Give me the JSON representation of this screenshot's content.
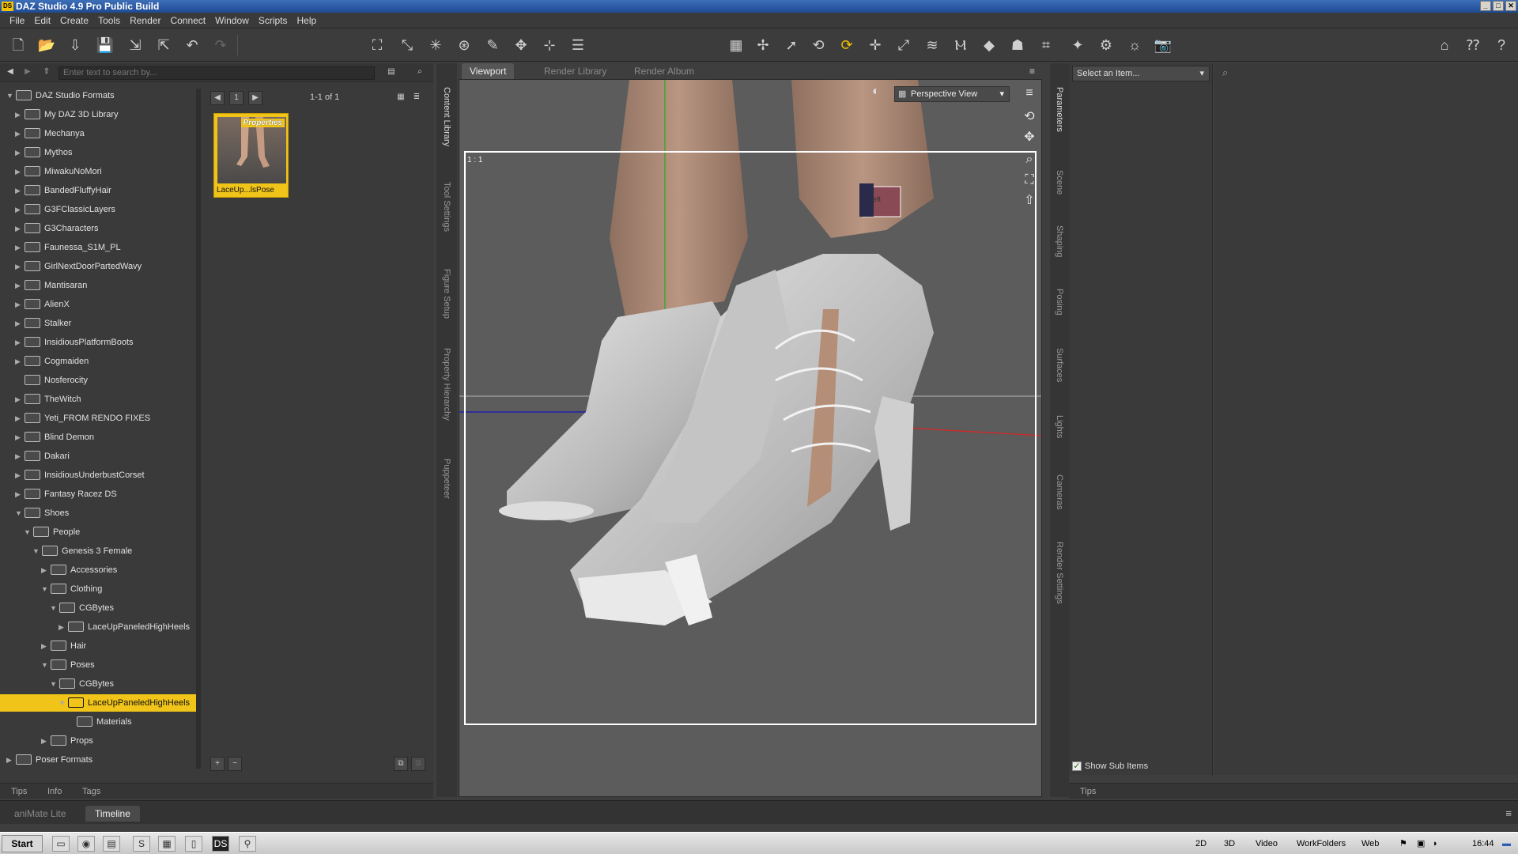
{
  "window": {
    "title": "DAZ Studio 4.9 Pro Public Build",
    "logo": "DS"
  },
  "menu": [
    "File",
    "Edit",
    "Create",
    "Tools",
    "Render",
    "Connect",
    "Window",
    "Scripts",
    "Help"
  ],
  "content_library": {
    "search_placeholder": "Enter text to search by...",
    "tree": [
      {
        "label": "DAZ Studio Formats",
        "depth": 0,
        "arrow": "down"
      },
      {
        "label": "My DAZ 3D Library",
        "depth": 1,
        "arrow": "right"
      },
      {
        "label": "Mechanya",
        "depth": 1,
        "arrow": "right"
      },
      {
        "label": "Mythos",
        "depth": 1,
        "arrow": "right"
      },
      {
        "label": "MiwakuNoMori",
        "depth": 1,
        "arrow": "right"
      },
      {
        "label": "BandedFluffyHair",
        "depth": 1,
        "arrow": "right"
      },
      {
        "label": "G3FClassicLayers",
        "depth": 1,
        "arrow": "right"
      },
      {
        "label": "G3Characters",
        "depth": 1,
        "arrow": "right"
      },
      {
        "label": "Faunessa_S1M_PL",
        "depth": 1,
        "arrow": "right"
      },
      {
        "label": "GirlNextDoorPartedWavy",
        "depth": 1,
        "arrow": "right"
      },
      {
        "label": "Mantisaran",
        "depth": 1,
        "arrow": "right"
      },
      {
        "label": "AlienX",
        "depth": 1,
        "arrow": "right"
      },
      {
        "label": "Stalker",
        "depth": 1,
        "arrow": "right"
      },
      {
        "label": "InsidiousPlatformBoots",
        "depth": 1,
        "arrow": "right"
      },
      {
        "label": "Cogmaiden",
        "depth": 1,
        "arrow": "right"
      },
      {
        "label": "Nosferocity",
        "depth": 1,
        "arrow": ""
      },
      {
        "label": "TheWitch",
        "depth": 1,
        "arrow": "right"
      },
      {
        "label": "Yeti_FROM RENDO FIXES",
        "depth": 1,
        "arrow": "right"
      },
      {
        "label": "Blind Demon",
        "depth": 1,
        "arrow": "right"
      },
      {
        "label": "Dakari",
        "depth": 1,
        "arrow": "right"
      },
      {
        "label": "InsidiousUnderbustCorset",
        "depth": 1,
        "arrow": "right"
      },
      {
        "label": "Fantasy Racez DS",
        "depth": 1,
        "arrow": "right"
      },
      {
        "label": "Shoes",
        "depth": 1,
        "arrow": "down"
      },
      {
        "label": "People",
        "depth": 2,
        "arrow": "down"
      },
      {
        "label": "Genesis 3 Female",
        "depth": 3,
        "arrow": "down"
      },
      {
        "label": "Accessories",
        "depth": 4,
        "arrow": "right"
      },
      {
        "label": "Clothing",
        "depth": 4,
        "arrow": "down"
      },
      {
        "label": "CGBytes",
        "depth": 5,
        "arrow": "down"
      },
      {
        "label": "LaceUpPaneledHighHeels",
        "depth": 6,
        "arrow": "right"
      },
      {
        "label": "Hair",
        "depth": 4,
        "arrow": "right"
      },
      {
        "label": "Poses",
        "depth": 4,
        "arrow": "down"
      },
      {
        "label": "CGBytes",
        "depth": 5,
        "arrow": "down"
      },
      {
        "label": "LaceUpPaneledHighHeels",
        "depth": 6,
        "arrow": "down",
        "selected": true
      },
      {
        "label": "Materials",
        "depth": 7,
        "arrow": ""
      },
      {
        "label": "Props",
        "depth": 4,
        "arrow": "right"
      },
      {
        "label": "Poser Formats",
        "depth": 0,
        "arrow": "right"
      }
    ],
    "page_number": "1",
    "page_count": "1-1 of 1",
    "thumb_badge": "Properties",
    "thumb_label": "LaceUp...lsPose",
    "tabs": [
      "Tips",
      "Info",
      "Tags"
    ],
    "side_tabs": [
      "Content Library",
      "Tool Settings",
      "Figure Setup",
      "Property Hierarchy",
      "Puppeteer"
    ]
  },
  "viewport": {
    "tabs": [
      "Viewport",
      "Render Library",
      "Render Album"
    ],
    "view_mode": "Perspective View",
    "aspect_label": "1 : 1",
    "cube_label": "Left"
  },
  "parameters": {
    "select_placeholder": "Select an Item...",
    "show_sub_items": "Show Sub Items",
    "tabs": [
      "Tips"
    ],
    "side_tabs": [
      "Parameters",
      "Scene",
      "Shaping",
      "Posing",
      "Surfaces",
      "Lights",
      "Cameras",
      "Render Settings"
    ]
  },
  "bottom_tabs": [
    "aniMate Lite",
    "Timeline"
  ],
  "taskbar": {
    "start": "Start",
    "tray_items": [
      "2D",
      "3D",
      "Video",
      "WorkFolders",
      "Web"
    ],
    "time": "16:44"
  },
  "colors": {
    "accent": "#f0c419",
    "panel": "#3a3a3a",
    "viewport_bg": "#5e5e5e"
  }
}
